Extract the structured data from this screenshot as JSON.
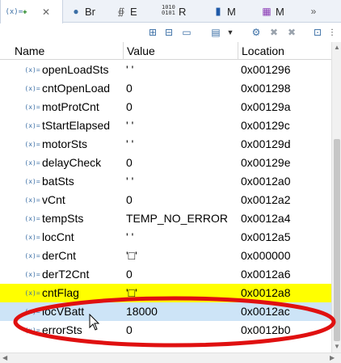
{
  "tabs": [
    {
      "label": "",
      "icon": "variables-icon",
      "active": true
    },
    {
      "label": "Br",
      "icon": "breakpoints-icon"
    },
    {
      "label": "E",
      "icon": "expressions-icon"
    },
    {
      "label": "R",
      "icon": "registers-icon"
    },
    {
      "label": "M",
      "icon": "memory-icon"
    },
    {
      "label": "M",
      "icon": "modules-icon"
    }
  ],
  "columns": {
    "name": "Name",
    "value": "Value",
    "location": "Location"
  },
  "rows": [
    {
      "name": "openLoadSts",
      "value": "' '",
      "location": "0x001296"
    },
    {
      "name": "cntOpenLoad",
      "value": "0",
      "location": "0x001298"
    },
    {
      "name": "motProtCnt",
      "value": "0",
      "location": "0x00129a"
    },
    {
      "name": "tStartElapsed",
      "value": "' '",
      "location": "0x00129c"
    },
    {
      "name": "motorSts",
      "value": "' '",
      "location": "0x00129d"
    },
    {
      "name": "delayCheck",
      "value": "0",
      "location": "0x00129e"
    },
    {
      "name": "batSts",
      "value": "' '",
      "location": "0x0012a0"
    },
    {
      "name": "vCnt",
      "value": "0",
      "location": "0x0012a2"
    },
    {
      "name": "tempSts",
      "value": "TEMP_NO_ERROR",
      "location": "0x0012a4"
    },
    {
      "name": "locCnt",
      "value": "' '",
      "location": "0x0012a5"
    },
    {
      "name": "derCnt",
      "value": "'□'",
      "location": "0x000000"
    },
    {
      "name": "derT2Cnt",
      "value": "0",
      "location": "0x0012a6"
    },
    {
      "name": "cntFlag",
      "value": "'□'",
      "location": "0x0012a8",
      "state": "highlight"
    },
    {
      "name": "locVBatt",
      "value": "18000",
      "location": "0x0012ac",
      "state": "selected"
    },
    {
      "name": "errorSts",
      "value": "0",
      "location": "0x0012b0"
    }
  ],
  "colors": {
    "highlight": "#ffff00",
    "selected": "#cde4f7",
    "annotation": "#e01010",
    "icon": "#3a6ea5"
  }
}
